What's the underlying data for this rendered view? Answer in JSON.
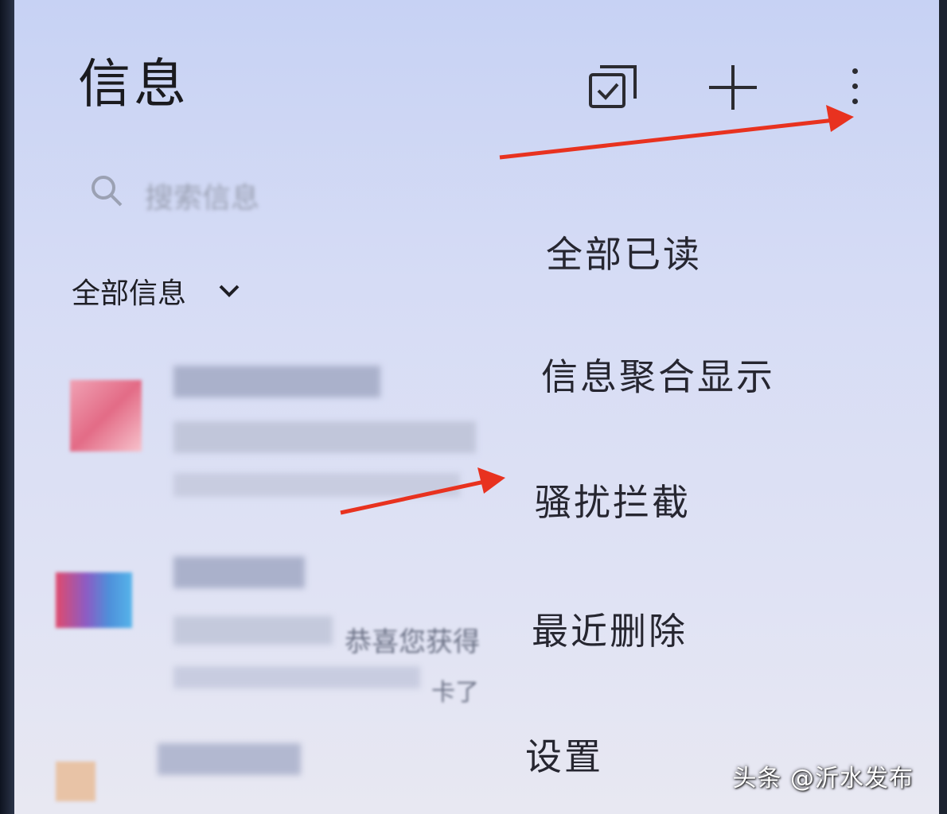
{
  "header": {
    "title": "信息"
  },
  "toolbar": {
    "select_icon": "checkbox-select-icon",
    "add_icon": "plus-icon",
    "more_icon": "more-vertical-icon"
  },
  "search": {
    "placeholder": "搜索信息",
    "icon": "search-icon"
  },
  "filter": {
    "label": "全部信息",
    "icon": "chevron-down-icon"
  },
  "conversations": [
    {
      "snippet_fragment": ""
    },
    {
      "snippet_fragment": "恭喜您获得",
      "sub_fragment": "卡了"
    },
    {
      "snippet_fragment": ""
    }
  ],
  "menu": {
    "items": [
      {
        "label": "全部已读"
      },
      {
        "label": "信息聚合显示"
      },
      {
        "label": "骚扰拦截"
      },
      {
        "label": "最近删除"
      },
      {
        "label": "设置"
      }
    ]
  },
  "annotations": {
    "arrow_color": "#e8321f"
  },
  "watermark": {
    "text": "头条 @沂水发布"
  }
}
